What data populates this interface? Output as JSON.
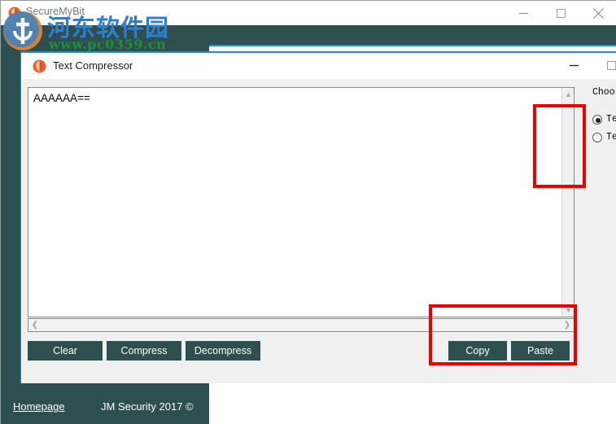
{
  "outer_window": {
    "title": "SecureMyBit",
    "icon": "shield-icon",
    "controls": {
      "minimize": "minimize-icon",
      "maximize": "maximize-icon",
      "close": "close-icon"
    }
  },
  "inner_window": {
    "title": "Text Compressor",
    "icon": "shield-icon",
    "controls": {
      "minimize": "minimize-icon",
      "maximize": "maximize-icon"
    },
    "textarea": {
      "value": "AAAAAA==",
      "vscroll_up": "chevron-up-icon",
      "vscroll_down": "chevron-down-icon",
      "hscroll_left": "chevron-left-icon",
      "hscroll_right": "chevron-right-icon"
    },
    "buttons": {
      "clear": "Clear",
      "compress": "Compress",
      "decompress": "Decompress",
      "copy": "Copy",
      "paste": "Paste"
    },
    "options": {
      "label": "Choose s",
      "radios": [
        {
          "label": "Text (",
          "checked": true
        },
        {
          "label": "Text ]",
          "checked": false
        }
      ]
    }
  },
  "footer": {
    "homepage": "Homepage",
    "copyright": "JM Security 2017 ©"
  },
  "watermark": {
    "site_name": "河东软件园",
    "url": "www.pc0359.cn"
  },
  "colors": {
    "teal": "#2d4f4f",
    "accent_blue": "#2e8bc8",
    "annotation_red": "#ee0000",
    "watermark_blue": "#2f7fd0",
    "watermark_green": "#1f8f3a"
  }
}
